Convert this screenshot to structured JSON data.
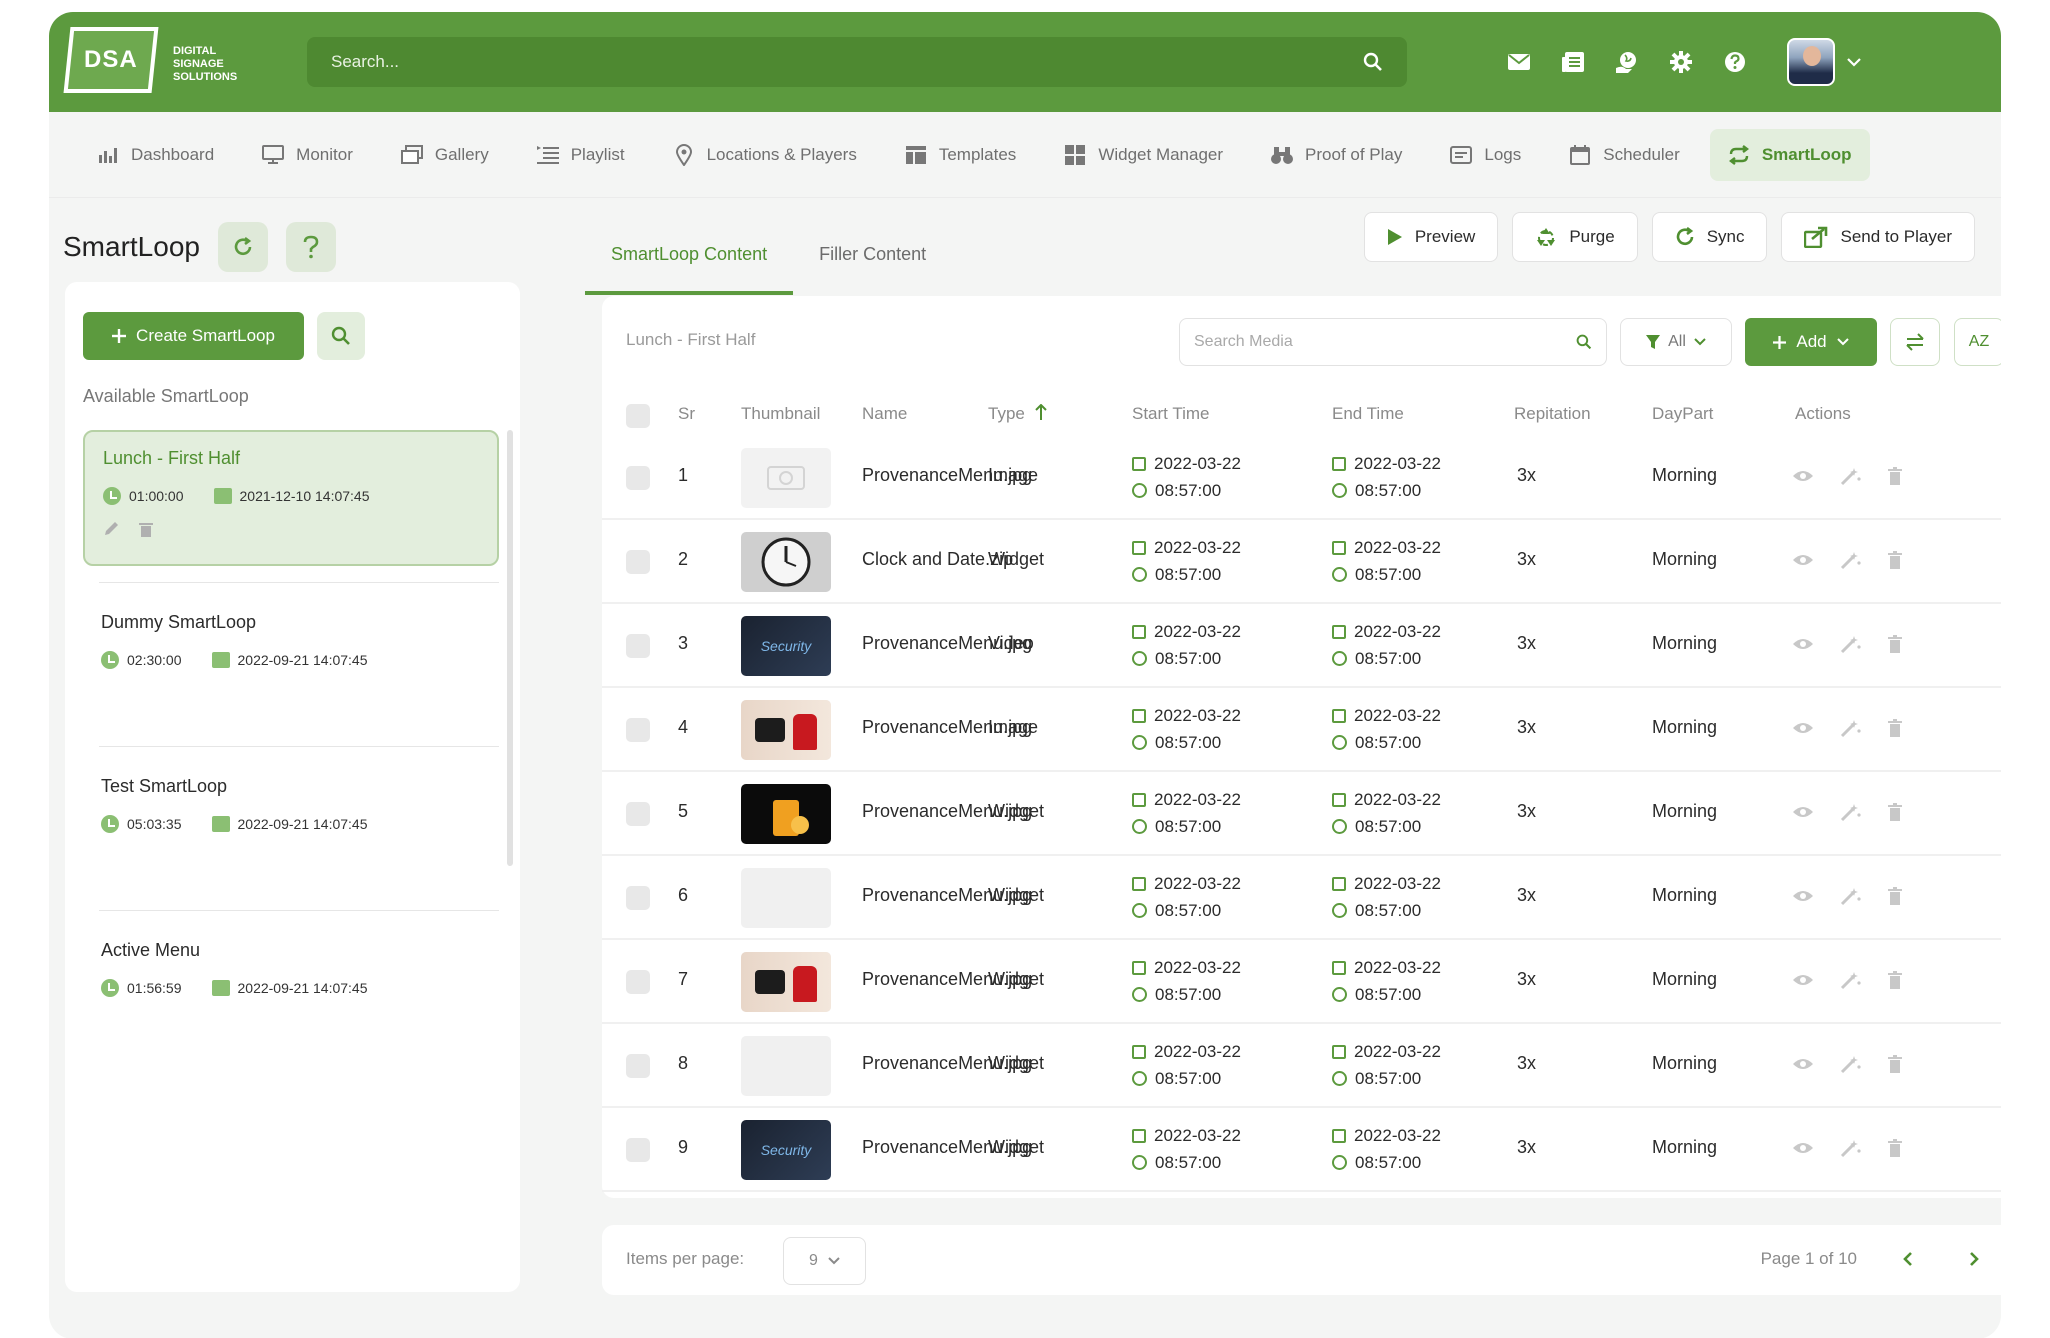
{
  "header": {
    "logo_text": "DSA",
    "logo_sub": "DIGITAL\nSIGNAGE\nSOLUTIONS",
    "search_placeholder": "Search..."
  },
  "nav": [
    {
      "label": "Dashboard",
      "icon": "chart-icon"
    },
    {
      "label": "Monitor",
      "icon": "monitor-icon"
    },
    {
      "label": "Gallery",
      "icon": "gallery-icon"
    },
    {
      "label": "Playlist",
      "icon": "playlist-icon"
    },
    {
      "label": "Locations & Players",
      "icon": "location-icon"
    },
    {
      "label": "Templates",
      "icon": "templates-icon"
    },
    {
      "label": "Widget Manager",
      "icon": "widget-icon"
    },
    {
      "label": "Proof of Play",
      "icon": "binoculars-icon"
    },
    {
      "label": "Logs",
      "icon": "logs-icon"
    },
    {
      "label": "Scheduler",
      "icon": "calendar-icon"
    },
    {
      "label": "SmartLoop",
      "icon": "loop-icon"
    }
  ],
  "page": {
    "title": "SmartLoop",
    "tabs": [
      "SmartLoop Content",
      "Filler Content"
    ],
    "tools": [
      "Preview",
      "Purge",
      "Sync",
      "Send to Player"
    ]
  },
  "left": {
    "create_label": "Create SmartLoop",
    "available_label": "Available SmartLoop",
    "loops": [
      {
        "title": "Lunch - First Half",
        "duration": "01:00:00",
        "date": "2021-12-10 14:07:45"
      },
      {
        "title": "Dummy SmartLoop",
        "duration": "02:30:00",
        "date": "2022-09-21 14:07:45"
      },
      {
        "title": "Test SmartLoop",
        "duration": "05:03:35",
        "date": "2022-09-21 14:07:45"
      },
      {
        "title": "Active Menu",
        "duration": "01:56:59",
        "date": "2022-09-21 14:07:45"
      }
    ]
  },
  "main": {
    "crumb": "Lunch - First Half",
    "search_placeholder": "Search Media",
    "filter_label": "All",
    "add_label": "Add",
    "sort_label": "AZ",
    "columns": {
      "sr": "Sr",
      "thumbnail": "Thumbnail",
      "name": "Name",
      "type": "Type",
      "start": "Start Time",
      "end": "End Time",
      "rep": "Repitation",
      "daypart": "DayPart",
      "actions": "Actions"
    },
    "rows": [
      {
        "sr": "1",
        "name": "ProvenanceMenu.jpg",
        "type": "Image",
        "sd": "2022-03-22",
        "st": "08:57:00",
        "ed": "2022-03-22",
        "et": "08:57:00",
        "rep": "3x",
        "daypart": "Morning",
        "thumb": "placeholder"
      },
      {
        "sr": "2",
        "name": "Clock and Date.zip",
        "type": "Widget",
        "sd": "2022-03-22",
        "st": "08:57:00",
        "ed": "2022-03-22",
        "et": "08:57:00",
        "rep": "3x",
        "daypart": "Morning",
        "thumb": "clock"
      },
      {
        "sr": "3",
        "name": "ProvenanceMenu.jpg",
        "type": "Video",
        "sd": "2022-03-22",
        "st": "08:57:00",
        "ed": "2022-03-22",
        "et": "08:57:00",
        "rep": "3x",
        "daypart": "Morning",
        "thumb": "security"
      },
      {
        "sr": "4",
        "name": "ProvenanceMenu.jpg",
        "type": "Image",
        "sd": "2022-03-22",
        "st": "08:57:00",
        "ed": "2022-03-22",
        "et": "08:57:00",
        "rep": "3x",
        "daypart": "Morning",
        "thumb": "shoes"
      },
      {
        "sr": "5",
        "name": "ProvenanceMenu.jpg",
        "type": "Widget",
        "sd": "2022-03-22",
        "st": "08:57:00",
        "ed": "2022-03-22",
        "et": "08:57:00",
        "rep": "3x",
        "daypart": "Morning",
        "thumb": "drink"
      },
      {
        "sr": "6",
        "name": "ProvenanceMenu.jpg",
        "type": "Widget",
        "sd": "2022-03-22",
        "st": "08:57:00",
        "ed": "2022-03-22",
        "et": "08:57:00",
        "rep": "3x",
        "daypart": "Morning",
        "thumb": "blank"
      },
      {
        "sr": "7",
        "name": "ProvenanceMenu.jpg",
        "type": "Widget",
        "sd": "2022-03-22",
        "st": "08:57:00",
        "ed": "2022-03-22",
        "et": "08:57:00",
        "rep": "3x",
        "daypart": "Morning",
        "thumb": "shoes"
      },
      {
        "sr": "8",
        "name": "ProvenanceMenu.jpg",
        "type": "Widget",
        "sd": "2022-03-22",
        "st": "08:57:00",
        "ed": "2022-03-22",
        "et": "08:57:00",
        "rep": "3x",
        "daypart": "Morning",
        "thumb": "blank"
      },
      {
        "sr": "9",
        "name": "ProvenanceMenu.jpg",
        "type": "Widget",
        "sd": "2022-03-22",
        "st": "08:57:00",
        "ed": "2022-03-22",
        "et": "08:57:00",
        "rep": "3x",
        "daypart": "Morning",
        "thumb": "security"
      }
    ]
  },
  "pager": {
    "items_label": "Items per page:",
    "per_page": "9",
    "page_text": "Page 1 of 10"
  },
  "colors": {
    "brand": "#5c9a3e",
    "brand_dark": "#4e8931",
    "brand_light": "#e3eedd"
  }
}
